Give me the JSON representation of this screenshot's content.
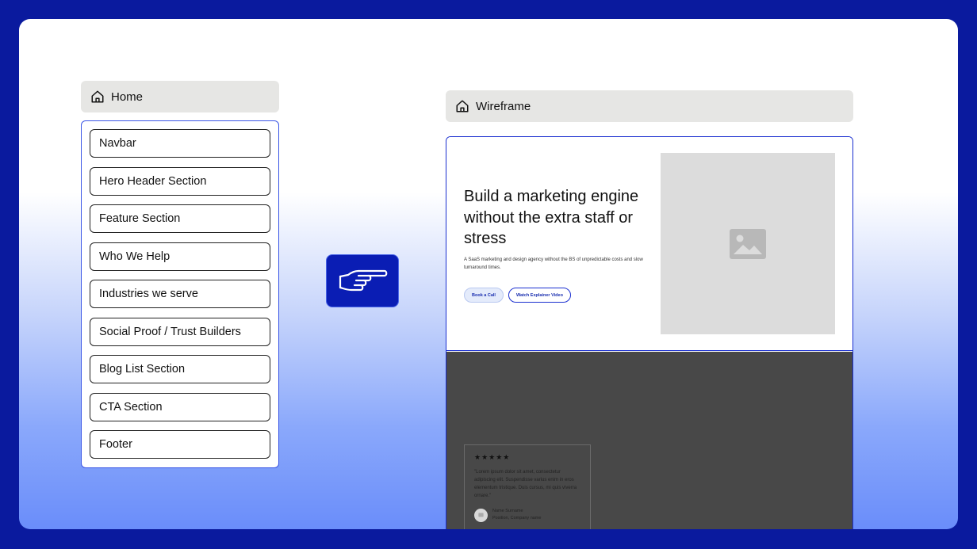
{
  "sitemap": {
    "page_title": "Home",
    "sections": [
      "Navbar",
      "Hero Header Section",
      "Feature Section",
      "Who We Help",
      "Industries we serve",
      "Social Proof / Trust Builders",
      "Blog List Section",
      "CTA Section",
      "Footer"
    ]
  },
  "wireframe": {
    "title": "Wireframe",
    "hero": {
      "headline": "Build a marketing engine without the extra staff or stress",
      "description": "A SaaS marketing and design agency without the BS of unpredictable costs and slow turnaround times.",
      "primary_button": "Book a Call",
      "secondary_button": "Watch Explainer Video"
    },
    "testimonial": {
      "stars": "★★★★★",
      "quote": "\"Lorem ipsum dolor sit amet, consectetur adipiscing elit. Suspendisse varius enim in eros elementum tristique. Duis cursus, mi quis viverra ornare.\"",
      "name": "Name Surname",
      "position": "Position, Company name"
    }
  },
  "colors": {
    "brand_blue": "#0a1a9e",
    "accent_blue": "#3a56e6",
    "placeholder_gray": "#dcdcdc",
    "dark_section": "#484848"
  },
  "icons": {
    "page_icon": "home-icon",
    "transfer_icon": "pointing-hand-icon",
    "image_icon": "image-icon"
  }
}
